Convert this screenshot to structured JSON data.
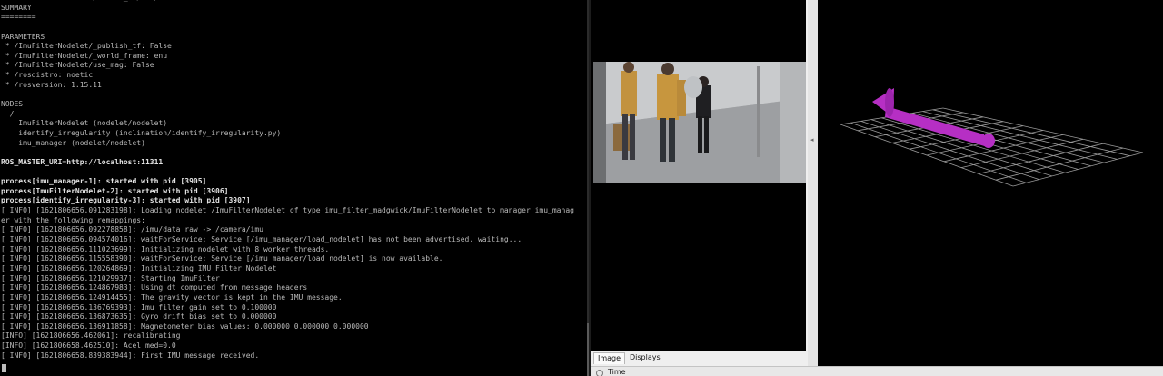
{
  "terminal": {
    "lines": [
      {
        "text": "                    ~/catkin_ws/src/...",
        "bold": false
      },
      {
        "text": "SUMMARY",
        "bold": false
      },
      {
        "text": "========",
        "bold": false
      },
      {
        "text": "",
        "bold": false
      },
      {
        "text": "PARAMETERS",
        "bold": false
      },
      {
        "text": " * /ImuFilterNodelet/_publish_tf: False",
        "bold": false
      },
      {
        "text": " * /ImuFilterNodelet/_world_frame: enu",
        "bold": false
      },
      {
        "text": " * /ImuFilterNodelet/use_mag: False",
        "bold": false
      },
      {
        "text": " * /rosdistro: noetic",
        "bold": false
      },
      {
        "text": " * /rosversion: 1.15.11",
        "bold": false
      },
      {
        "text": "",
        "bold": false
      },
      {
        "text": "NODES",
        "bold": false
      },
      {
        "text": "  /",
        "bold": false
      },
      {
        "text": "    ImuFilterNodelet (nodelet/nodelet)",
        "bold": false
      },
      {
        "text": "    identify_irregularity (inclination/identify_irregularity.py)",
        "bold": false
      },
      {
        "text": "    imu_manager (nodelet/nodelet)",
        "bold": false
      },
      {
        "text": "",
        "bold": false
      },
      {
        "text": "ROS_MASTER_URI=http://localhost:11311",
        "bold": true
      },
      {
        "text": "",
        "bold": false
      },
      {
        "text": "process[imu_manager-1]: started with pid [3905]",
        "bold": true
      },
      {
        "text": "process[ImuFilterNodelet-2]: started with pid [3906]",
        "bold": true
      },
      {
        "text": "process[identify_irregularity-3]: started with pid [3907]",
        "bold": true
      },
      {
        "text": "[ INFO] [1621806656.091283198]: Loading nodelet /ImuFilterNodelet of type imu_filter_madgwick/ImuFilterNodelet to manager imu_manag",
        "bold": false
      },
      {
        "text": "er with the following remappings:",
        "bold": false
      },
      {
        "text": "[ INFO] [1621806656.092278858]: /imu/data_raw -> /camera/imu",
        "bold": false
      },
      {
        "text": "[ INFO] [1621806656.094574016]: waitForService: Service [/imu_manager/load_nodelet] has not been advertised, waiting...",
        "bold": false
      },
      {
        "text": "[ INFO] [1621806656.111023699]: Initializing nodelet with 8 worker threads.",
        "bold": false
      },
      {
        "text": "[ INFO] [1621806656.115558390]: waitForService: Service [/imu_manager/load_nodelet] is now available.",
        "bold": false
      },
      {
        "text": "[ INFO] [1621806656.120264869]: Initializing IMU Filter Nodelet",
        "bold": false
      },
      {
        "text": "[ INFO] [1621806656.121029937]: Starting ImuFilter",
        "bold": false
      },
      {
        "text": "[ INFO] [1621806656.124867983]: Using dt computed from message headers",
        "bold": false
      },
      {
        "text": "[ INFO] [1621806656.124914455]: The gravity vector is kept in the IMU message.",
        "bold": false
      },
      {
        "text": "[ INFO] [1621806656.136769393]: Imu filter gain set to 0.100000",
        "bold": false
      },
      {
        "text": "[ INFO] [1621806656.136873635]: Gyro drift bias set to 0.000000",
        "bold": false
      },
      {
        "text": "[ INFO] [1621806656.136911858]: Magnetometer bias values: 0.000000 0.000000 0.000000",
        "bold": false
      },
      {
        "text": "[INFO] [1621806656.462061]: recalibrating",
        "bold": false
      },
      {
        "text": "[INFO] [1621806658.462510]: Acel med=0.0",
        "bold": false
      },
      {
        "text": "[ INFO] [1621806658.839383944]: First IMU message received.",
        "bold": false
      }
    ]
  },
  "rviz": {
    "tabs": [
      "Image",
      "Displays"
    ],
    "time_label": "Time",
    "arrow_color": "#b62fc4",
    "grid_color": "#9a9a9a"
  }
}
